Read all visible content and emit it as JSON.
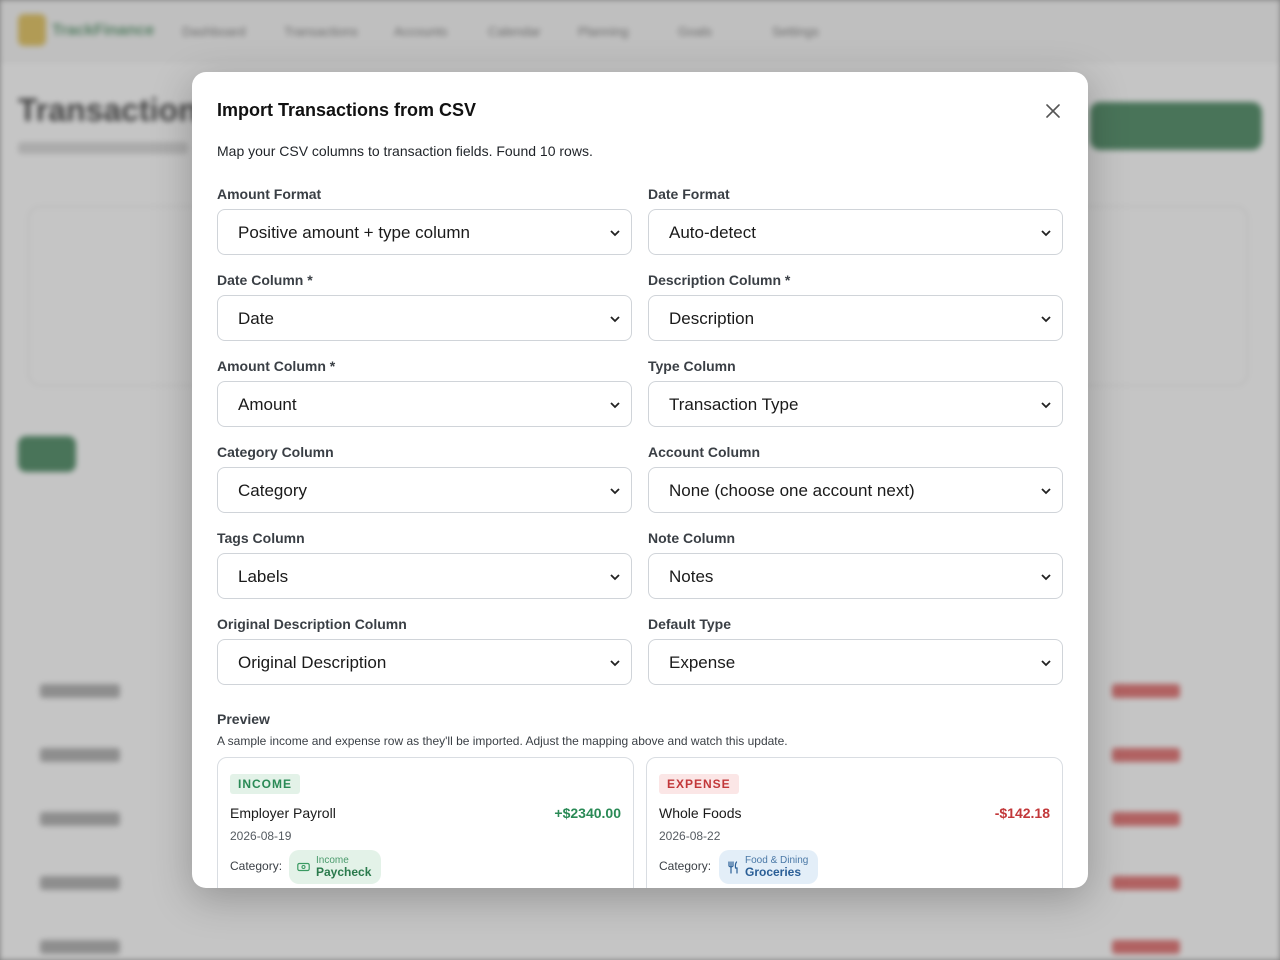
{
  "background": {
    "app_name": "TrackFinance",
    "nav_items": [
      "Dashboard",
      "Transactions",
      "Accounts",
      "Calendar",
      "Planning",
      "Goals",
      "Settings"
    ],
    "page_title": "Transactions"
  },
  "modal": {
    "title": "Import Transactions from CSV",
    "description": "Map your CSV columns to transaction fields. Found 10 rows.",
    "fields": [
      {
        "label": "Amount Format",
        "value": "Positive amount + type column"
      },
      {
        "label": "Date Format",
        "value": "Auto-detect"
      },
      {
        "label": "Date Column *",
        "value": "Date"
      },
      {
        "label": "Description Column *",
        "value": "Description"
      },
      {
        "label": "Amount Column *",
        "value": "Amount"
      },
      {
        "label": "Type Column",
        "value": "Transaction Type"
      },
      {
        "label": "Category Column",
        "value": "Category"
      },
      {
        "label": "Account Column",
        "value": "None (choose one account next)"
      },
      {
        "label": "Tags Column",
        "value": "Labels"
      },
      {
        "label": "Note Column",
        "value": "Notes"
      },
      {
        "label": "Original Description Column",
        "value": "Original Description"
      },
      {
        "label": "Default Type",
        "value": "Expense"
      }
    ],
    "preview": {
      "title": "Preview",
      "description": "A sample income and expense row as they'll be imported. Adjust the mapping above and watch this update.",
      "category_label": "Category:",
      "income": {
        "badge": "INCOME",
        "name": "Employer Payroll",
        "amount": "+$2340.00",
        "date": "2026-08-19",
        "category_parent": "Income",
        "category_child": "Paycheck",
        "icon": "money-icon"
      },
      "expense": {
        "badge": "EXPENSE",
        "name": "Whole Foods",
        "amount": "-$142.18",
        "date": "2026-08-22",
        "category_parent": "Food & Dining",
        "category_child": "Groceries",
        "icon": "fork-knife-icon"
      }
    }
  },
  "colors": {
    "income": "#2a8a56",
    "expense": "#c2383a",
    "brand_green": "#1d6b3a"
  }
}
